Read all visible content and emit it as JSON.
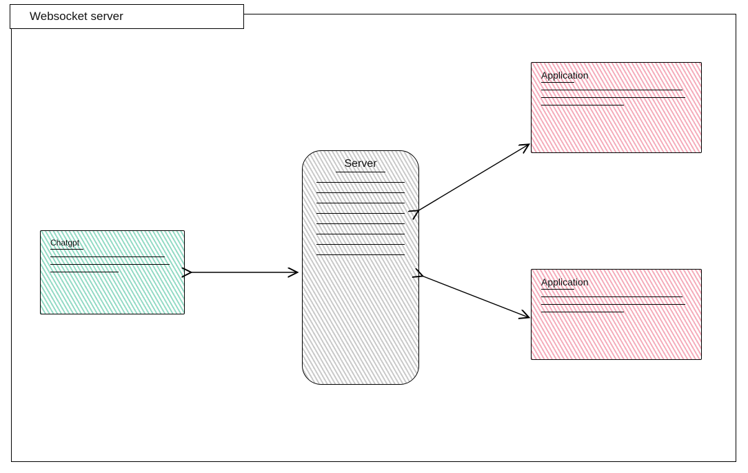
{
  "title": "Websocket server",
  "nodes": {
    "chatgpt": {
      "label": "Chatgpt"
    },
    "server": {
      "label": "Server"
    },
    "app1": {
      "label": "Application"
    },
    "app2": {
      "label": "Application"
    }
  },
  "edges": [
    {
      "from": "chatgpt",
      "to": "server",
      "bidirectional": true
    },
    {
      "from": "server",
      "to": "app1",
      "bidirectional": true
    },
    {
      "from": "server",
      "to": "app2",
      "bidirectional": true
    }
  ],
  "colors": {
    "chatgpt_fill": "#55c4a2",
    "server_fill": "#bdbdbd",
    "application_fill": "#e66a87",
    "stroke": "#000000"
  }
}
